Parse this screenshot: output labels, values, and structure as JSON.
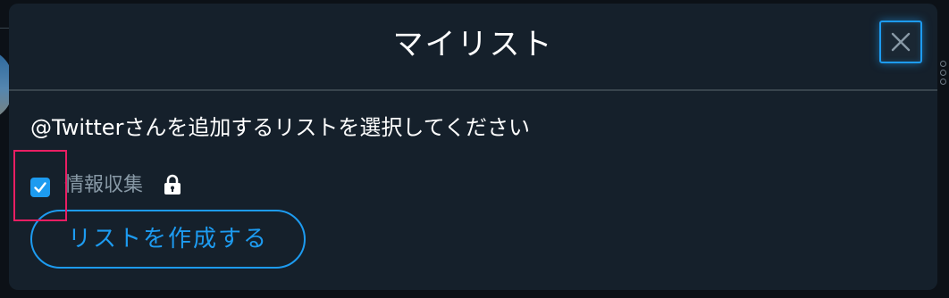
{
  "modal": {
    "title": "マイリスト",
    "close_icon": "close-icon"
  },
  "prompt": "@Twitterさんを追加するリストを選択してください",
  "lists": [
    {
      "name": "情報収集",
      "checked": true,
      "private": true,
      "icon": "lock-icon"
    }
  ],
  "create_list_label": "リストを作成する",
  "colors": {
    "accent": "#1d9bf0",
    "modal_bg": "#15202b",
    "highlight": "#e91e63"
  }
}
